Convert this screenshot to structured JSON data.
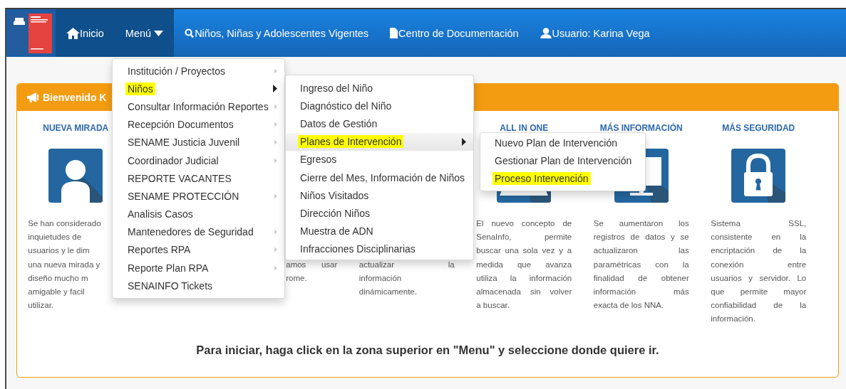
{
  "navbar": {
    "items": [
      {
        "kind": "home",
        "label": "Inicio",
        "selected": true
      },
      {
        "kind": "dropdown",
        "label": "Menú",
        "selected": true
      },
      {
        "kind": "search",
        "label": "Niños, Niñas y Adolescentes Vigentes",
        "selected": false
      },
      {
        "kind": "document",
        "label": "Centro de Documentación",
        "selected": false
      },
      {
        "kind": "user",
        "label": "Usuario: Karina Vega",
        "selected": false
      }
    ]
  },
  "menu": {
    "items": [
      {
        "label": "Institución / Proyectos",
        "has_submenu": true,
        "open": false,
        "selected": false,
        "highlighted": false
      },
      {
        "label": "Niños",
        "has_submenu": true,
        "open": true,
        "selected": false,
        "highlighted": true
      },
      {
        "label": "Consultar Información Reportes",
        "has_submenu": true,
        "open": false,
        "selected": false,
        "highlighted": false
      },
      {
        "label": "Recepción Documentos",
        "has_submenu": true,
        "open": false,
        "selected": false,
        "highlighted": false
      },
      {
        "label": "SENAME Justicia Juvenil",
        "has_submenu": true,
        "open": false,
        "selected": false,
        "highlighted": false
      },
      {
        "label": "Coordinador Judicial",
        "has_submenu": true,
        "open": false,
        "selected": false,
        "highlighted": false
      },
      {
        "label": "REPORTE VACANTES",
        "has_submenu": false,
        "selected": false,
        "highlighted": false
      },
      {
        "label": "SENAME PROTECCIÓN",
        "has_submenu": true,
        "open": false,
        "selected": false,
        "highlighted": false
      },
      {
        "label": "Analisis Casos",
        "has_submenu": false,
        "selected": false,
        "highlighted": false
      },
      {
        "label": "Mantenedores de Seguridad",
        "has_submenu": true,
        "open": false,
        "selected": false,
        "highlighted": false
      },
      {
        "label": "Reportes RPA",
        "has_submenu": true,
        "open": false,
        "selected": false,
        "highlighted": false
      },
      {
        "label": "Reporte Plan RPA",
        "has_submenu": true,
        "open": false,
        "selected": false,
        "highlighted": false
      },
      {
        "label": "SENAINFO Tickets",
        "has_submenu": false,
        "selected": false,
        "highlighted": false
      }
    ]
  },
  "submenu": {
    "items": [
      {
        "label": "Ingreso del Niño",
        "has_submenu": false,
        "selected": false,
        "highlighted": false
      },
      {
        "label": "Diagnóstico del Niño",
        "has_submenu": false,
        "selected": false,
        "highlighted": false
      },
      {
        "label": "Datos de Gestión",
        "has_submenu": false,
        "selected": false,
        "highlighted": false
      },
      {
        "label": "Planes de Intervención",
        "has_submenu": true,
        "open": true,
        "selected": true,
        "highlighted": true
      },
      {
        "label": "Egresos",
        "has_submenu": false,
        "selected": false,
        "highlighted": false
      },
      {
        "label": "Cierre del Mes, Información de Niños",
        "has_submenu": false,
        "selected": false,
        "highlighted": false
      },
      {
        "label": "Niños Visitados",
        "has_submenu": false,
        "selected": false,
        "highlighted": false
      },
      {
        "label": "Dirección Niños",
        "has_submenu": false,
        "selected": false,
        "highlighted": false
      },
      {
        "label": "Muestra de ADN",
        "has_submenu": false,
        "selected": false,
        "highlighted": false
      },
      {
        "label": "Infracciones Disciplinarias",
        "has_submenu": false,
        "selected": false,
        "highlighted": false
      }
    ]
  },
  "submenu_2": {
    "items": [
      {
        "label": "Nuevo Plan de Intervención",
        "has_submenu": false,
        "selected": false,
        "highlighted": false
      },
      {
        "label": "Gestionar Plan de Intervención",
        "has_submenu": false,
        "selected": false,
        "highlighted": false
      },
      {
        "label": "Proceso Intervención",
        "has_submenu": false,
        "selected": false,
        "highlighted": true
      }
    ]
  },
  "panel": {
    "title": "Bienvenido K",
    "columns": [
      {
        "kind": "person",
        "title": "NUEVA MIRADA",
        "lines": [
          "Se han considerado",
          "inquietudes de",
          "usuarios y le dim",
          "una nueva mirada y",
          "diseño mucho m",
          "amigable y facil",
          "utilizar."
        ]
      },
      {
        "kind": "covered-left",
        "lines": [
          "amos usar",
          "rome."
        ]
      },
      {
        "kind": "covered-top",
        "lines": [
          "actualizar la",
          "información",
          "dinámicamente."
        ]
      },
      {
        "kind": "laptop",
        "title": "ALL IN ONE",
        "lines": [
          "El nuevo concepto de",
          "SenaInfo, permite",
          "buscar una sola vez y a",
          "medida que avanza",
          "utiliza la información",
          "almacenada sin volver",
          "a buscar."
        ]
      },
      {
        "kind": "monitor",
        "title": "MÁS INFORMACIÓN",
        "lines": [
          "Se aumentaron los",
          "registros de datos y se",
          "actualizaron las",
          "paramétricas con la",
          "finalidad de obtener",
          "información más",
          "exacta de los NNA."
        ]
      },
      {
        "kind": "lock",
        "title": "MÁS SEGURIDAD",
        "lines": [
          "Sistema SSL,",
          "consistente en la",
          "encriptación de la",
          "conexión entre",
          "usuarios y servidor. Lo",
          "que permite mayor",
          "confiabilidad de la",
          "información."
        ]
      }
    ],
    "footer_text": "Para iniciar, haga click en la zona superior en \"Menu\" y seleccione donde quiere ir."
  }
}
